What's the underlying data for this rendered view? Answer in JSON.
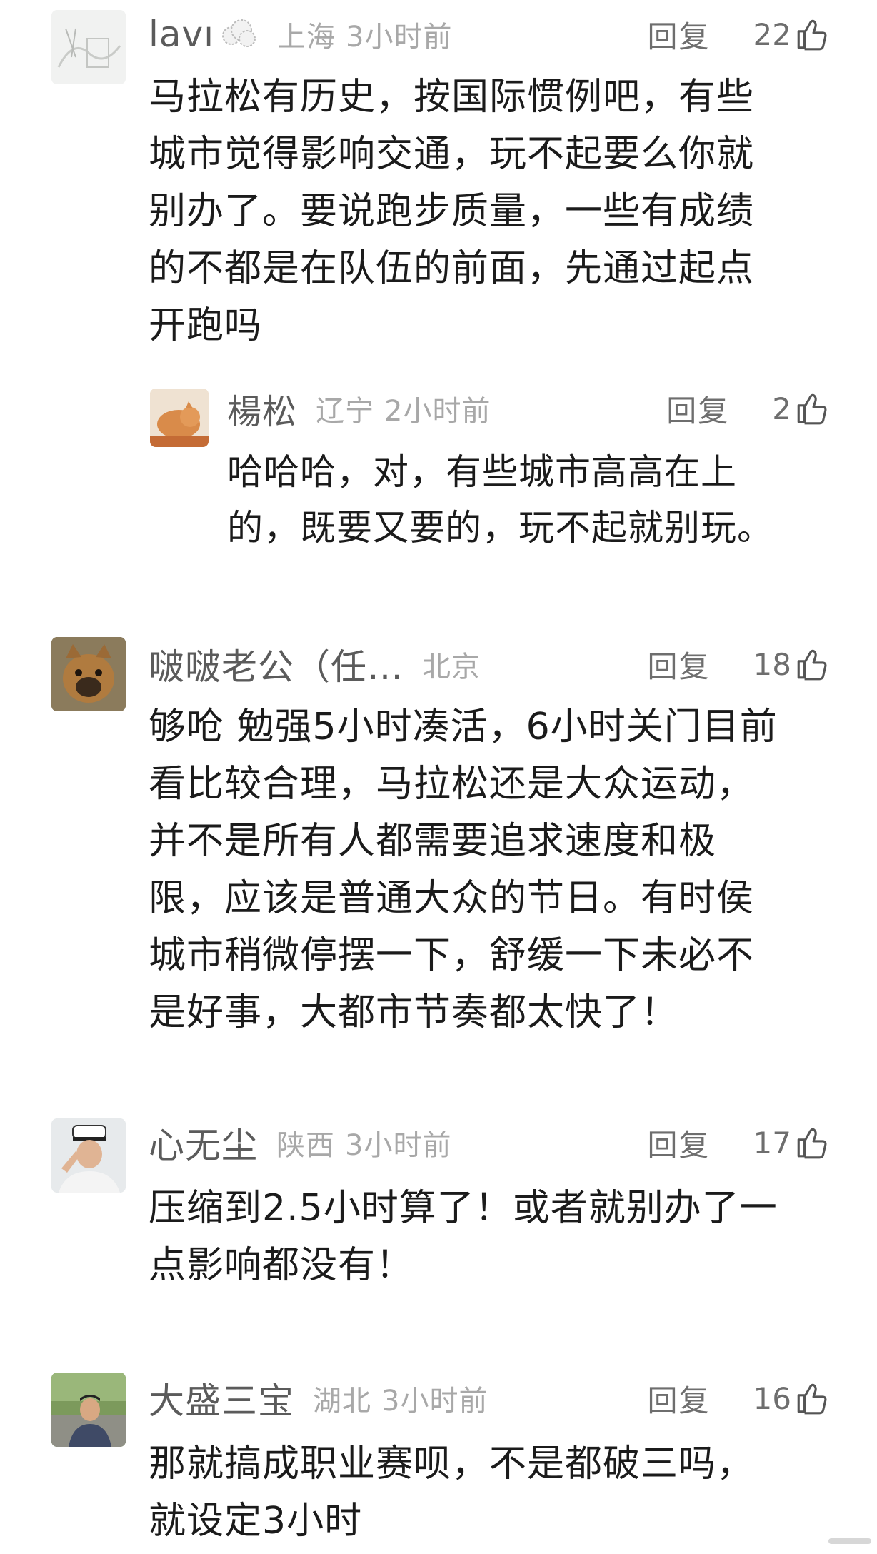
{
  "reply_label": "回复",
  "comments": [
    {
      "user": "lavı",
      "region": "上海",
      "time": "3小时前",
      "likes": "22",
      "text_lines": [
        "马拉松有历史，按国际惯例吧，有些",
        "城市觉得影响交通，玩不起要么你就",
        "别办了。要说跑步质量，一些有成绩",
        "的不都是在队伍的前面，先通过起点",
        "开跑吗"
      ],
      "replies": [
        {
          "user": "楊松",
          "region": "辽宁",
          "time": "2小时前",
          "likes": "2",
          "text_lines": [
            "哈哈哈，对，有些城市高高在上",
            "的，既要又要的，玩不起就别玩。"
          ]
        }
      ]
    },
    {
      "user": "啵啵老公（任…",
      "region": "北京",
      "time": "",
      "likes": "18",
      "text_lines": [
        "够呛 勉强5小时凑活，6小时关门目前",
        "看比较合理，马拉松还是大众运动，",
        "并不是所有人都需要追求速度和极",
        "限，应该是普通大众的节日。有时侯",
        "城市稍微停摆一下，舒缓一下未必不",
        "是好事，大都市节奏都太快了！"
      ]
    },
    {
      "user": "心无尘",
      "region": "陕西",
      "time": "3小时前",
      "likes": "17",
      "text_lines": [
        "压缩到2.5小时算了！或者就别办了一",
        "点影响都没有！"
      ]
    },
    {
      "user": "大盛三宝",
      "region": "湖北",
      "time": "3小时前",
      "likes": "16",
      "text_lines": [
        "那就搞成职业赛呗，不是都破三吗，",
        "就设定3小时"
      ]
    }
  ]
}
